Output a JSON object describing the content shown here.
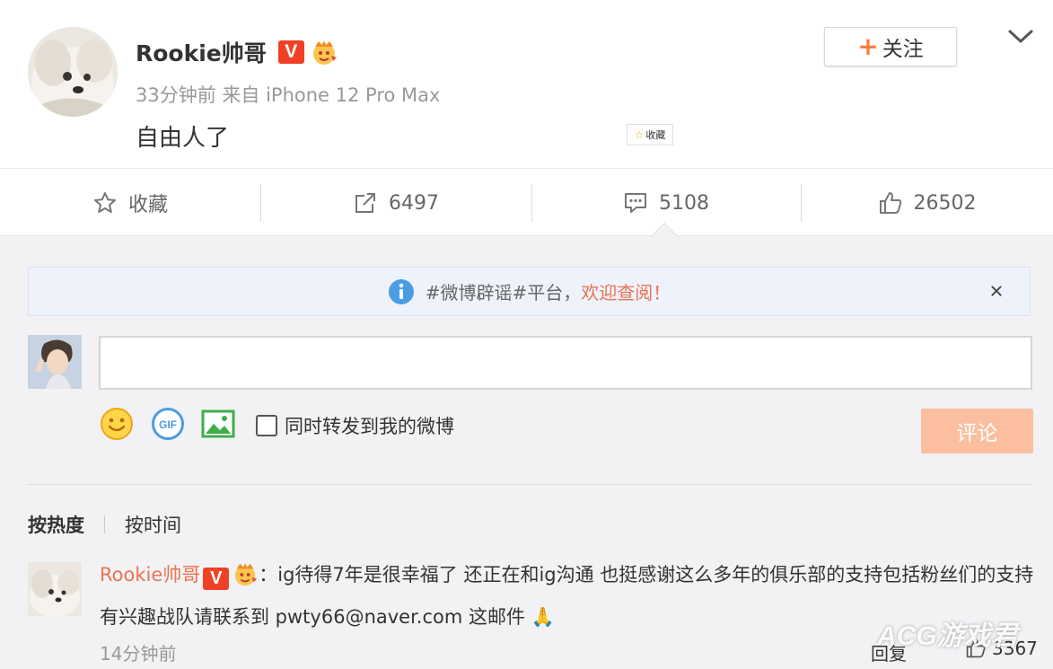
{
  "post": {
    "author": "Rookie帅哥",
    "verified_badge": "V",
    "meta": "33分钟前 来自 iPhone 12 Pro Max",
    "text": "自由人了",
    "mini_fav_label": "收藏",
    "follow_label": "关注"
  },
  "actions": {
    "favorite_label": "收藏",
    "forward_count": "6497",
    "comment_count": "5108",
    "like_count": "26502"
  },
  "notice": {
    "text": "#微博辟谣#平台，",
    "highlight": "欢迎查阅！"
  },
  "composer": {
    "comment_value": "",
    "repost_label": "同时转发到我的微博",
    "repost_checked": false,
    "submit_label": "评论"
  },
  "sort": {
    "tabs": [
      "按热度",
      "按时间"
    ],
    "active": "按热度"
  },
  "comment": {
    "author": "Rookie帅哥",
    "verified_badge": "V",
    "separator": "：",
    "text": "ig待得7年是很幸福了 还正在和ig沟通 也挺感谢这么多年的俱乐部的支持包括粉丝们的支持  有兴趣战队请联系到 pwty66@naver.com 这邮件 🙏",
    "time": "14分钟前",
    "reply_label": "回复",
    "like_count": "3367"
  },
  "watermark": "ACG游戏君",
  "colors": {
    "accent": "#eb7350",
    "follow_plus": "#fa7d3c",
    "submit_disabled": "#fbbf9f",
    "verified_red": "#f04124",
    "notice_bg": "#eef2fb",
    "info_blue": "#4a9de3"
  }
}
